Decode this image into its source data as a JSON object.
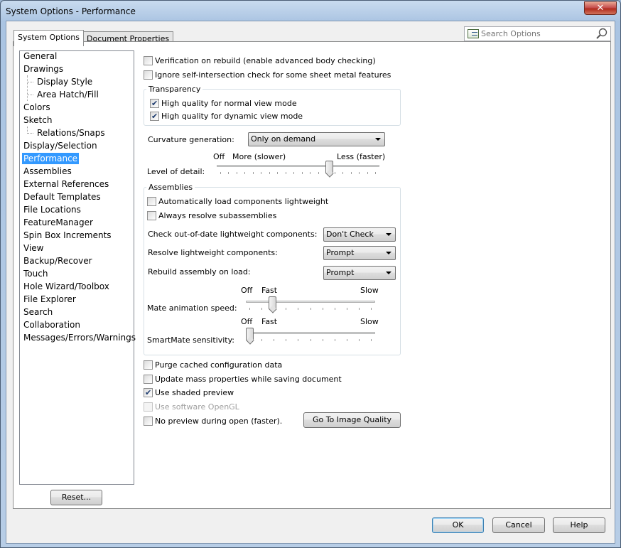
{
  "window": {
    "title": "System Options - Performance",
    "close_label": "✕"
  },
  "tabs": [
    {
      "label": "System Options"
    },
    {
      "label": "Document Properties"
    }
  ],
  "search": {
    "placeholder": "Search Options"
  },
  "tree": {
    "items": [
      {
        "label": "General"
      },
      {
        "label": "Drawings"
      },
      {
        "label": "Display Style"
      },
      {
        "label": "Area Hatch/Fill"
      },
      {
        "label": "Colors"
      },
      {
        "label": "Sketch"
      },
      {
        "label": "Relations/Snaps"
      },
      {
        "label": "Display/Selection"
      },
      {
        "label": "Performance"
      },
      {
        "label": "Assemblies"
      },
      {
        "label": "External References"
      },
      {
        "label": "Default Templates"
      },
      {
        "label": "File Locations"
      },
      {
        "label": "FeatureManager"
      },
      {
        "label": "Spin Box Increments"
      },
      {
        "label": "View"
      },
      {
        "label": "Backup/Recover"
      },
      {
        "label": "Touch"
      },
      {
        "label": "Hole Wizard/Toolbox"
      },
      {
        "label": "File Explorer"
      },
      {
        "label": "Search"
      },
      {
        "label": "Collaboration"
      },
      {
        "label": "Messages/Errors/Warnings"
      }
    ],
    "selected": "Performance"
  },
  "reset_label": "Reset...",
  "options": {
    "verification": {
      "label": "Verification on rebuild (enable advanced body checking)",
      "checked": false
    },
    "ignore_self_intersection": {
      "label": "Ignore self-intersection check for some sheet metal features",
      "checked": false
    },
    "transparency": {
      "title": "Transparency",
      "normal": {
        "label": "High quality for normal view mode",
        "checked": true
      },
      "dynamic": {
        "label": "High quality for dynamic view mode",
        "checked": true
      }
    },
    "curvature": {
      "label": "Curvature generation:",
      "value": "Only on demand"
    },
    "level_of_detail": {
      "label": "Level of detail:",
      "off": "Off",
      "more": "More (slower)",
      "less": "Less (faster)",
      "position_fraction": 0.7
    },
    "assemblies": {
      "title": "Assemblies",
      "auto_lightweight": {
        "label": "Automatically load components lightweight",
        "checked": false
      },
      "always_resolve": {
        "label": "Always resolve subassemblies",
        "checked": false
      },
      "check_outdated": {
        "label": "Check out-of-date lightweight components:",
        "value": "Don't Check"
      },
      "resolve_lightweight": {
        "label": "Resolve lightweight components:",
        "value": "Prompt"
      },
      "rebuild_on_load": {
        "label": "Rebuild assembly on load:",
        "value": "Prompt"
      },
      "mate_animation": {
        "label": "Mate animation speed:",
        "off": "Off",
        "fast": "Fast",
        "slow": "Slow",
        "position_fraction": 0.19
      },
      "smartmate": {
        "label": "SmartMate sensitivity:",
        "off": "Off",
        "fast": "Fast",
        "slow": "Slow",
        "position_fraction": 0.0
      }
    },
    "purge_cached": {
      "label": "Purge cached configuration data",
      "checked": false
    },
    "update_mass": {
      "label": "Update mass properties while saving document",
      "checked": false
    },
    "shaded_preview": {
      "label": "Use shaded preview",
      "checked": true
    },
    "software_opengl": {
      "label": "Use software OpenGL",
      "checked": false,
      "disabled": true
    },
    "no_preview": {
      "label": "No preview during open (faster).",
      "checked": false
    },
    "image_quality_button": "Go To Image Quality"
  },
  "footer": {
    "ok": "OK",
    "cancel": "Cancel",
    "help": "Help"
  },
  "colors": {
    "selection": "#3399ff",
    "accent_border": "#3c7fb1"
  }
}
